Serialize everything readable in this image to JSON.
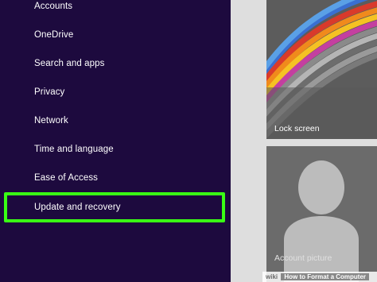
{
  "sidebar": {
    "items": [
      {
        "label": "Accounts"
      },
      {
        "label": "OneDrive"
      },
      {
        "label": "Search and apps"
      },
      {
        "label": "Privacy"
      },
      {
        "label": "Network"
      },
      {
        "label": "Time and language"
      },
      {
        "label": "Ease of Access"
      },
      {
        "label": "Update and recovery",
        "highlighted": true
      }
    ]
  },
  "tiles": {
    "lock_screen": {
      "label": "Lock screen"
    },
    "account_picture": {
      "label": "Account picture"
    }
  },
  "watermark": {
    "logo": "wiki",
    "text": "How to Format a Computer"
  },
  "colors": {
    "sidebar_background": "#1d0a3e",
    "highlight_border": "#39ff14",
    "pane_background": "#dedede"
  }
}
